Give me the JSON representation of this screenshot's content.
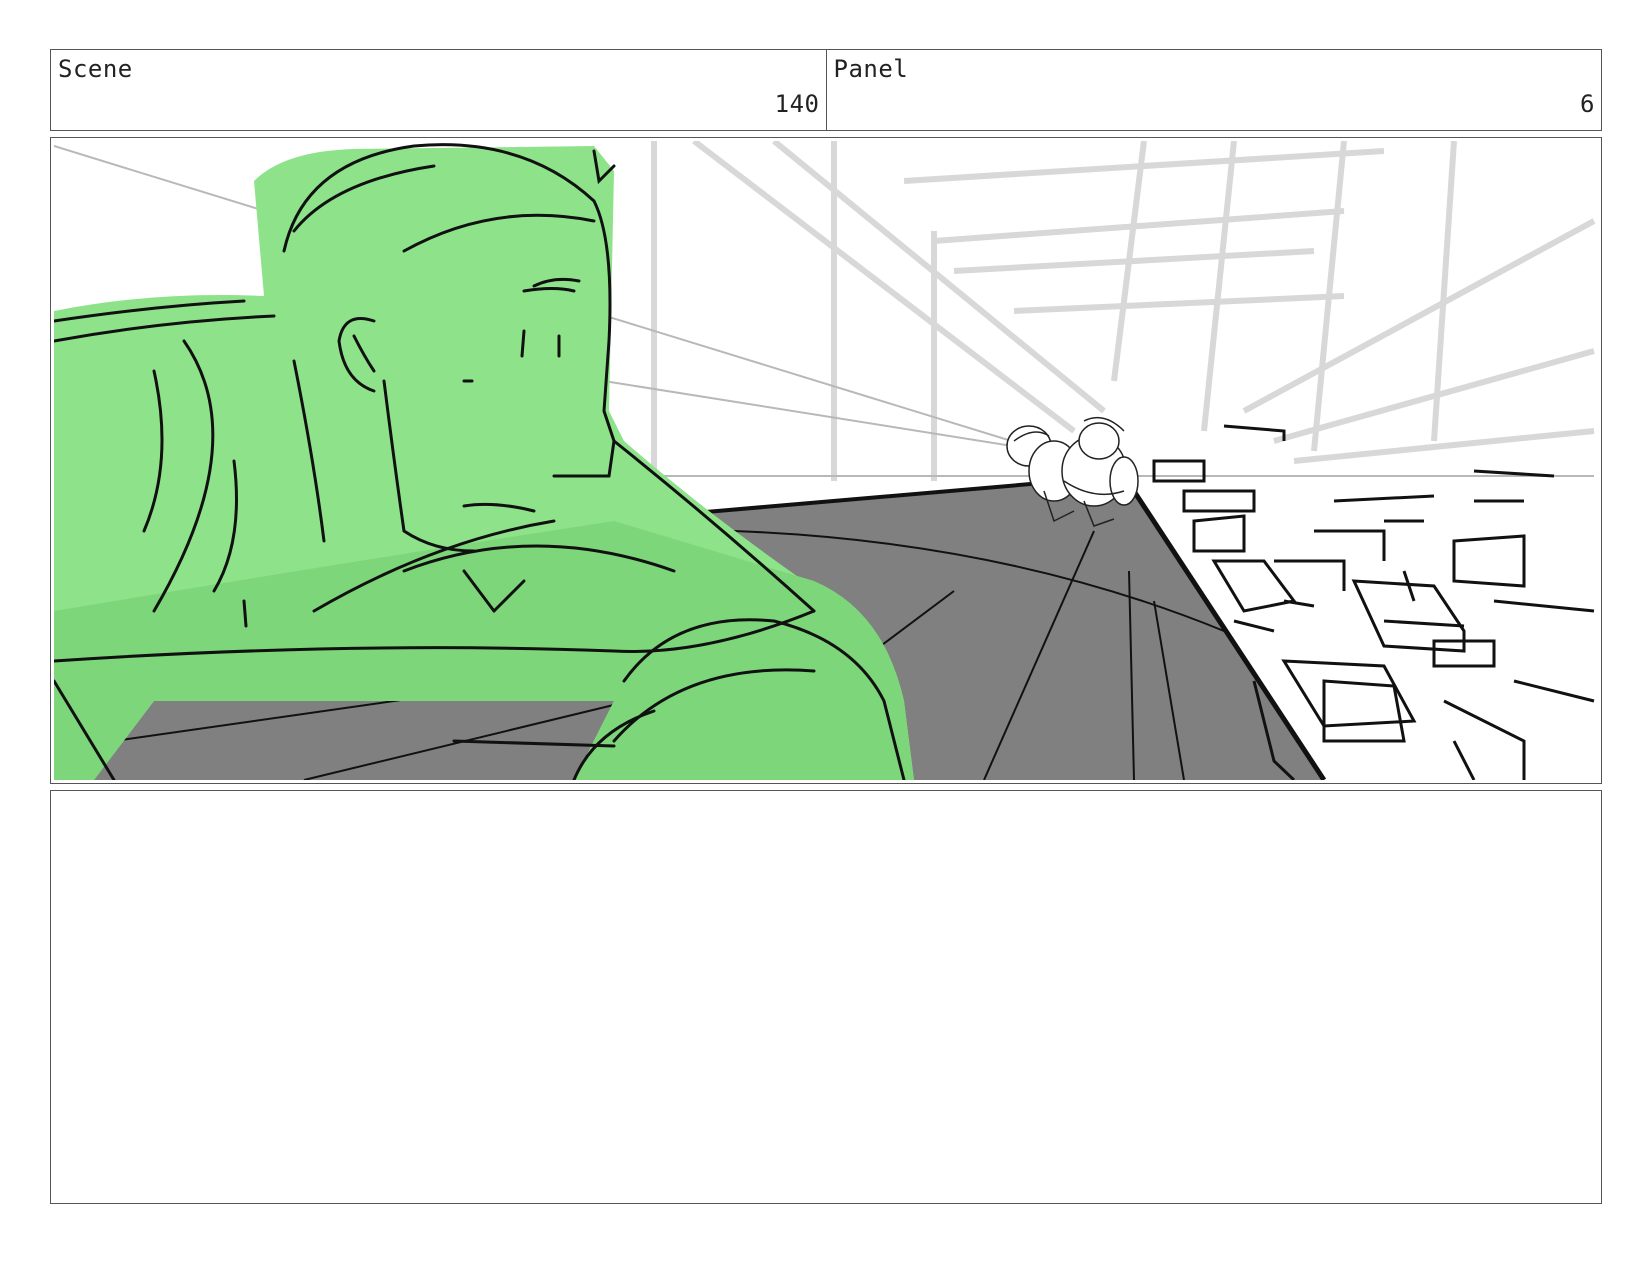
{
  "header": {
    "scene_label": "Scene",
    "scene_number": "140",
    "panel_label": "Panel",
    "panel_number": "6"
  },
  "colors": {
    "character_fill": "#8ee38a",
    "floor_fill": "#808080",
    "line": "#111111",
    "border": "#555555"
  },
  "notes": {
    "text": ""
  }
}
